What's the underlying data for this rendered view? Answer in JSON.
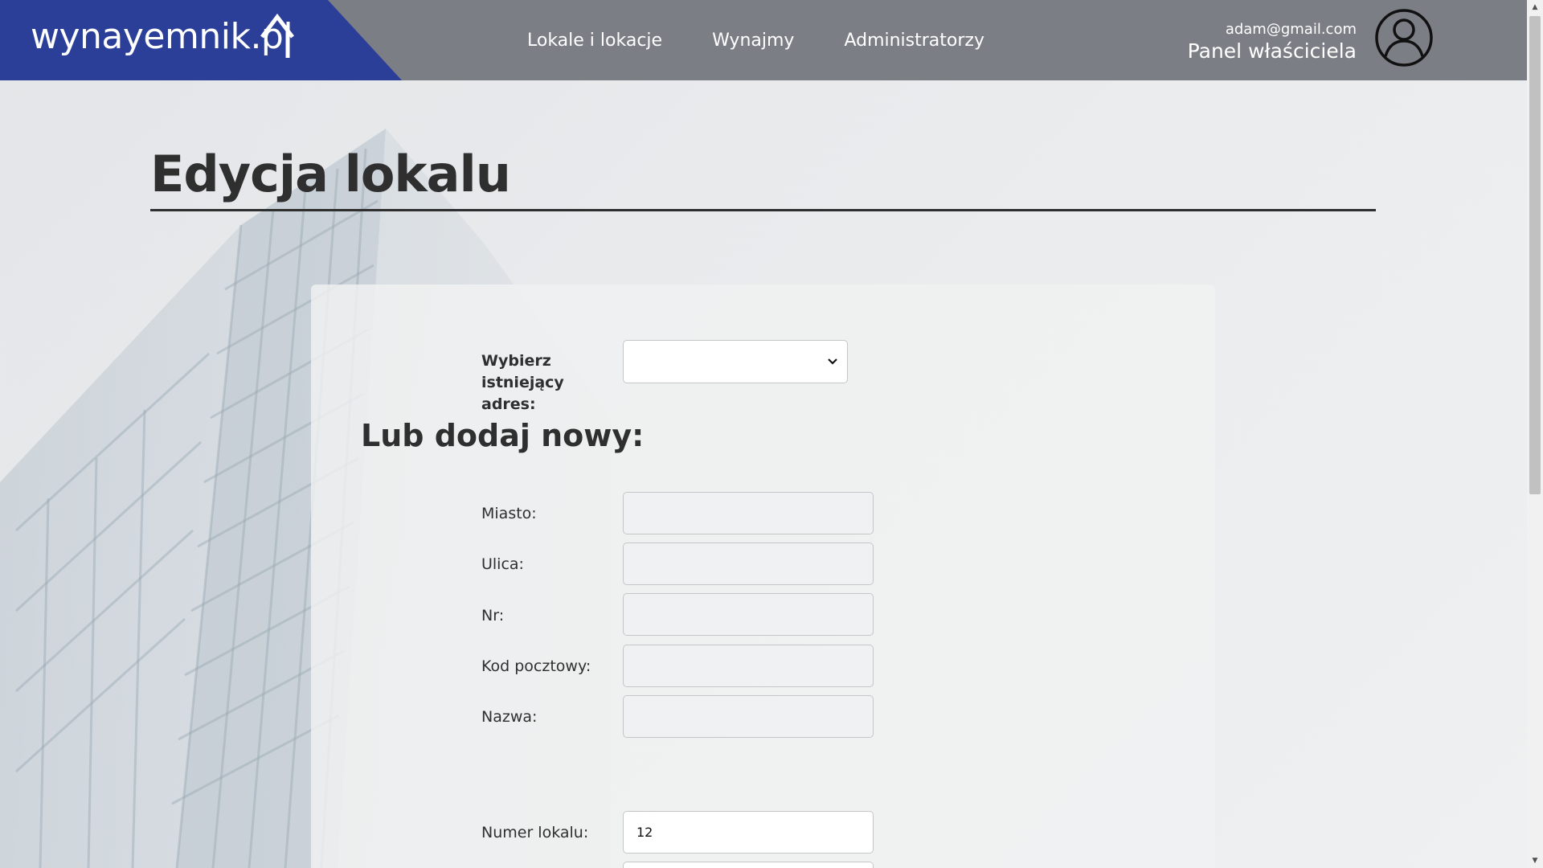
{
  "header": {
    "logo_text": "wynayemnik.pl",
    "nav": [
      {
        "label": "Lokale i lokacje"
      },
      {
        "label": "Wynajmy"
      },
      {
        "label": "Administratorzy"
      }
    ],
    "user_email": "adam@gmail.com",
    "user_panel": "Panel właściciela",
    "colors": {
      "bar": "#7c7e86",
      "logo_bg": "#2b3f98"
    }
  },
  "page": {
    "title": "Edycja lokalu"
  },
  "form": {
    "existing_address_label": "Wybierz istniejący adres:",
    "existing_address_value": "",
    "subheading": "Lub dodaj nowy:",
    "fields": {
      "miasto": {
        "label": "Miasto:",
        "value": ""
      },
      "ulica": {
        "label": "Ulica:",
        "value": ""
      },
      "nr": {
        "label": "Nr:",
        "value": ""
      },
      "kod": {
        "label": "Kod pocztowy:",
        "value": ""
      },
      "nazwa": {
        "label": "Nazwa:",
        "value": ""
      },
      "numer_lokalu": {
        "label": "Numer lokalu:",
        "value": "12"
      }
    }
  }
}
